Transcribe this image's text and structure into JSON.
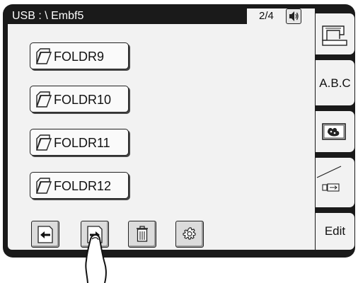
{
  "header": {
    "path": "USB : \\ Embf5",
    "page_indicator": "2/4"
  },
  "folders": [
    {
      "name": "FOLDR9"
    },
    {
      "name": "FOLDR10"
    },
    {
      "name": "FOLDR11"
    },
    {
      "name": "FOLDR12"
    }
  ],
  "toolbar": {
    "icons": [
      "page-back-icon",
      "page-forward-icon",
      "trash-icon",
      "settings-icon"
    ]
  },
  "tabs": {
    "machine_icon": "sewing-machine-icon",
    "abc_label": "A.B.C",
    "embroidery_icon": "embroidery-pattern-icon",
    "usb_icon": "usb-icon",
    "edit_label": "Edit"
  }
}
